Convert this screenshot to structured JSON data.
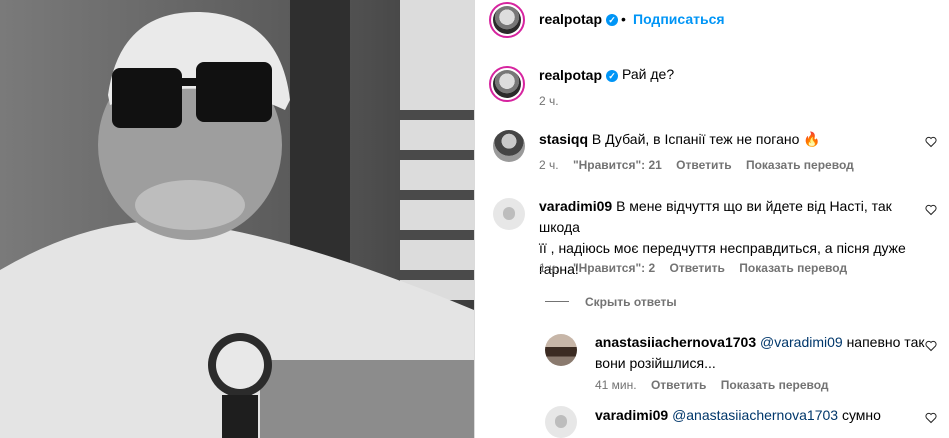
{
  "post": {
    "author": "realpotap",
    "follow_label": "Подписаться",
    "dot": "•",
    "caption": "Рай де?",
    "caption_time": "2 ч."
  },
  "comments": [
    {
      "user": "stasiqq",
      "text": "В Дубай, в Іспанії теж не погано 🔥",
      "time": "2 ч.",
      "likes": "\"Нравится\": 21",
      "reply_label": "Ответить",
      "translate_label": "Показать перевод"
    },
    {
      "user": "varadimi09",
      "text_line1": "В мене відчуття що ви йдете від Насті, так шкода",
      "text_line2": "її , надіюсь моє передчуття несправдиться, а пісня дуже",
      "text_line3": "гарна!",
      "time": "1 ч.",
      "likes": "\"Нравится\": 2",
      "reply_label": "Ответить",
      "translate_label": "Показать перевод"
    }
  ],
  "hide_replies_label": "Скрыть ответы",
  "replies": [
    {
      "user": "anastasiiachernova1703",
      "mention": "@varadimi09",
      "text_line1": "напевно так",
      "text_line2": "вони розійшлися...",
      "time": "41 мин.",
      "reply_label": "Ответить",
      "translate_label": "Показать перевод"
    },
    {
      "user": "varadimi09",
      "mention": "@anastasiiachernova1703",
      "text": "сумно"
    }
  ]
}
